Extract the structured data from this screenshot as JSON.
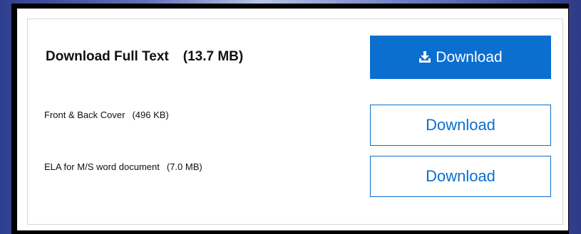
{
  "full_text": {
    "label": "Download Full Text",
    "size": "(13.7 MB)",
    "button_label": "Download",
    "button_icon": "download-icon",
    "accent_color": "#0a6fcf"
  },
  "files": [
    {
      "label": "Front & Back Cover",
      "size": "(496 KB)",
      "button_label": "Download"
    },
    {
      "label": "ELA for M/S word document",
      "size": "(7.0 MB)",
      "button_label": "Download"
    }
  ]
}
